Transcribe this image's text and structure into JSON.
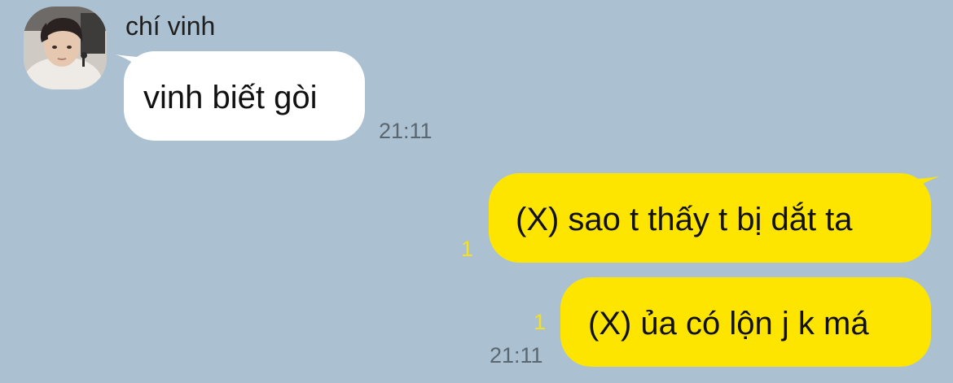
{
  "chat": {
    "sender": {
      "name": "chí vinh",
      "avatar": "profile-photo"
    },
    "messages": [
      {
        "direction": "incoming",
        "text": "vinh biết gòi",
        "time": "21:11"
      },
      {
        "direction": "outgoing",
        "text": "(X) sao t thấy t bị dắt ta",
        "unread": "1"
      },
      {
        "direction": "outgoing",
        "text": "(X) ủa có lộn j k má",
        "unread": "1",
        "time": "21:11"
      }
    ]
  },
  "colors": {
    "background": "#abc1d1",
    "incoming_bubble": "#ffffff",
    "outgoing_bubble": "#fee500",
    "unread_count": "#f6e11a",
    "timestamp": "#5a6670"
  }
}
